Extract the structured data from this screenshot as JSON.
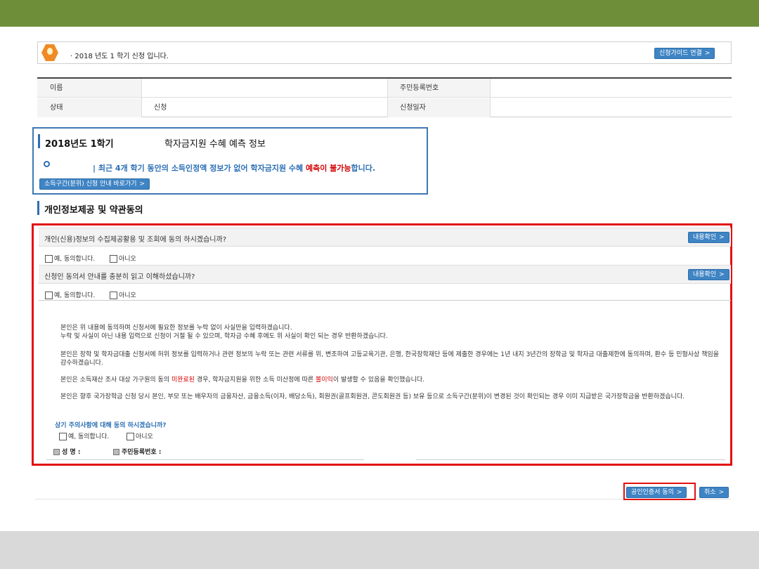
{
  "notice": {
    "text": "· 2018 년도 1 학기 신청 입니다.",
    "guide_button": "신청가이드 연결",
    "icon": "bulb-icon"
  },
  "info_table": {
    "name_label": "이름",
    "name_value": "",
    "rrn_label": "주민등록번호",
    "rrn_value": "",
    "status_label": "상태",
    "status_value": "신청",
    "date_label": "신청일자",
    "date_value": ""
  },
  "prediction": {
    "term": "2018년도 1학기",
    "title": "학자금지원 수혜 예측 정보",
    "message_blue": "| 최근 4개 학기 동안의 소득인정액 정보가 없어 학자금지원 수혜 ",
    "message_red": "예측이 불가능",
    "message_end": "합니다.",
    "link_button": "소득구간(분위) 신청 안내 바로가기"
  },
  "consent_section": {
    "title": "개인정보제공 및 약관동의",
    "q1": "개인(신용)정보의 수집제공활용 및 조회에 동의 하시겠습니까?",
    "q1_button": "내용확인",
    "q1_yes": "예, 동의합니다.",
    "q1_no": "아니오",
    "q2": "신청인 동의서 안내를 충분히 읽고 이해하셨습니까?",
    "q2_button": "내용확인",
    "q2_yes": "예, 동의합니다.",
    "q2_no": "아니오",
    "p1a": "본인은 위 내용에 동의하며 신청서에 필요한 정보를 누락 없이 사실만을 입력하겠습니다.",
    "p1b": "누락 및 사실이 아닌 내용 입력으로 신청이 거절 될 수 있으며, 학자금 수혜 후에도 위 사실이 확인 되는 경우 반환하겠습니다.",
    "p2": "본인은 장학 및 학자금대출 신청서에 허위 정보를 입력하거나 관련 정보의 누락 또는 관련 서류를 위, 변조하여 고등교육기관, 은행, 한국장학재단 등에 제출한 경우에는 1년 내지 3년간의 장학금 및 학자금 대출제한에 동의하며, 환수 등 민형사상 책임을 감수하겠습니다.",
    "p3_pre": "본인은 소득재산 조사 대상 가구원의 동의 ",
    "p3_red1": "미완료된",
    "p3_mid": " 경우, 학자금지원을 위한 소득 미산정에 따른 ",
    "p3_red2": "불이익",
    "p3_end": "이 발생할 수 있음을 확인했습니다.",
    "p4": "본인은 향후 국가장학금 신청 당시 본인, 부모 또는 배우자의 금융자산, 금융소득(이자, 배당소득), 회원권(골프회원권, 콘도회원권 등) 보유 등으로 소득구간(분위)이 변경된 것이 확인되는 경우 이미 지급받은 국가장학금을 반환하겠습니다.",
    "q3": "상기 주의사항에 대해 동의 하시겠습니까?",
    "q3_yes": "예, 동의합니다.",
    "q3_no": "아니오",
    "sign_name_label": "성 명 :",
    "sign_rrn_label": "주민등록번호 :"
  },
  "actions": {
    "cert_button": "공인인증서 동의",
    "cancel_button": "취소"
  },
  "colors": {
    "topbar": "#6e8e3a",
    "accent_blue": "#3f84c4",
    "highlight_red": "#e21010"
  }
}
